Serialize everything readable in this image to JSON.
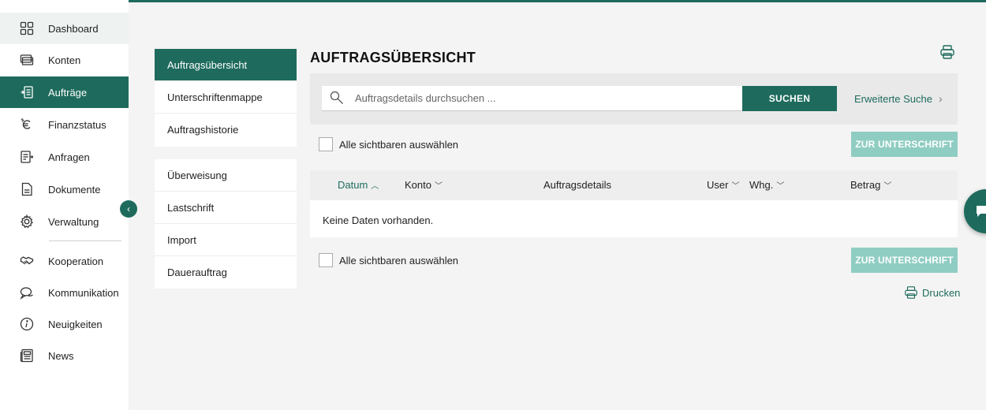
{
  "sidebar": {
    "items": [
      {
        "label": "Dashboard",
        "icon": "grid-icon"
      },
      {
        "label": "Konten",
        "icon": "cards-icon"
      },
      {
        "label": "Aufträge",
        "icon": "orders-icon"
      },
      {
        "label": "Finanzstatus",
        "icon": "euro-icon"
      },
      {
        "label": "Anfragen",
        "icon": "request-icon"
      },
      {
        "label": "Dokumente",
        "icon": "document-icon"
      },
      {
        "label": "Verwaltung",
        "icon": "gear-icon"
      },
      {
        "label": "Kooperation",
        "icon": "handshake-icon"
      },
      {
        "label": "Kommunikation",
        "icon": "chat-bubbles-icon"
      },
      {
        "label": "Neuigkeiten",
        "icon": "info-icon"
      },
      {
        "label": "News",
        "icon": "newspaper-icon"
      }
    ],
    "active": "Aufträge",
    "collapse_glyph": "‹"
  },
  "subnav": {
    "group1": [
      "Auftragsübersicht",
      "Unterschriftenmappe",
      "Auftragshistorie"
    ],
    "group2": [
      "Überweisung",
      "Lastschrift",
      "Import",
      "Dauerauftrag"
    ],
    "active": "Auftragsübersicht"
  },
  "main": {
    "title": "AUFTRAGSÜBERSICHT",
    "search": {
      "placeholder": "Auftragsdetails durchsuchen ...",
      "value": "",
      "button": "SUCHEN",
      "advanced": "Erweiterte Suche",
      "advanced_chevron": "›"
    },
    "select_all": "Alle sichtbaren auswählen",
    "sign_button": "ZUR UNTERSCHRIFT",
    "table": {
      "columns": [
        {
          "label": "Datum",
          "arrow": "︿",
          "sorted": true
        },
        {
          "label": "Konto",
          "arrow": "﹀"
        },
        {
          "label": "Auftragsdetails",
          "arrow": ""
        },
        {
          "label": "User",
          "arrow": "﹀"
        },
        {
          "label": "Whg.",
          "arrow": "﹀"
        },
        {
          "label": "Betrag",
          "arrow": "﹀"
        }
      ],
      "empty_text": "Keine Daten vorhanden."
    },
    "print_label": "Drucken"
  },
  "colors": {
    "primary": "#1e6b5d",
    "disabled_button": "#8fcdc3",
    "panel": "#e9e9e9"
  }
}
